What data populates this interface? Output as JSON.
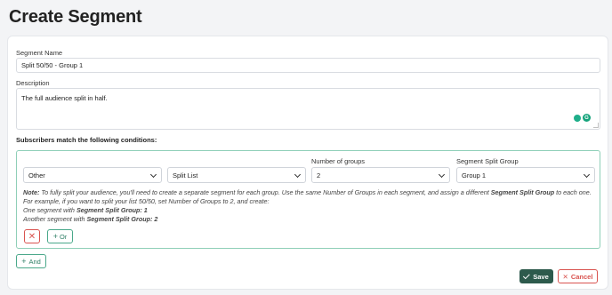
{
  "page": {
    "title": "Create Segment"
  },
  "form": {
    "segment_name_label": "Segment Name",
    "segment_name_value": "Split 50/50 - Group 1",
    "description_label": "Description",
    "description_value": "The full audience split in half.",
    "conditions_title": "Subscribers match the following conditions:"
  },
  "condition": {
    "field_select": "Other",
    "operator_select": "Split List",
    "groups_label": "Number of groups",
    "groups_value": "2",
    "split_group_label": "Segment Split Group",
    "split_group_value": "Group 1",
    "note": {
      "prefix": "Note:",
      "t1": " To fully split your audience, you'll need to create a separate segment for each group. Use the same Number of Groups in each segment, and assign a different ",
      "b1": "Segment Split Group",
      "t2": " to each one. For example, if you want to split your list 50/50, set Number of Groups to 2, and create:",
      "line2_text": "One segment with ",
      "line2_bold": "Segment Split Group: 1",
      "line3_text": "Another segment with ",
      "line3_bold": "Segment Split Group: 2"
    },
    "remove_label": "✕",
    "or_label": "Or"
  },
  "actions": {
    "and_label": "And",
    "save_label": "Save",
    "cancel_label": "Cancel"
  },
  "colors": {
    "accent_green": "#2d5a4c",
    "outline_green": "#4aa88a",
    "danger_red": "#d9534f"
  }
}
